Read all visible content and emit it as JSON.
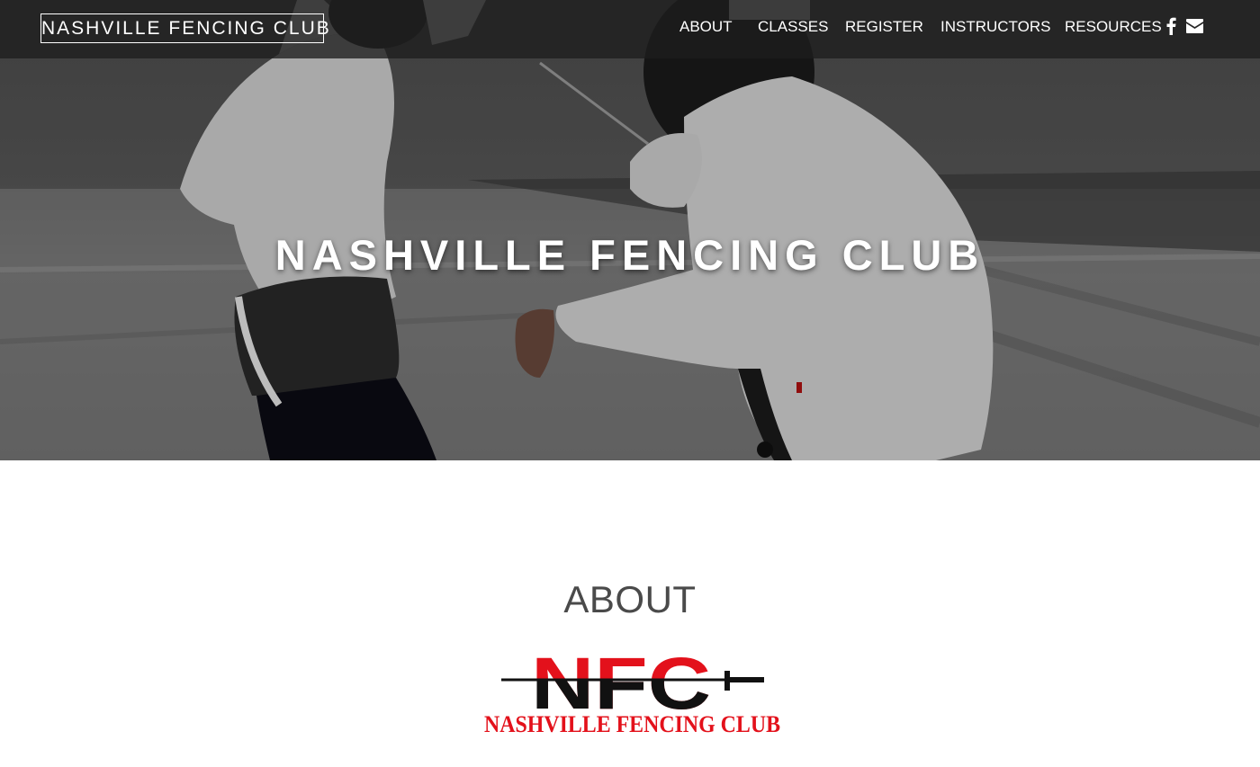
{
  "navbar": {
    "brand": "NASHVILLE FENCING CLUB",
    "links": [
      {
        "label": "ABOUT"
      },
      {
        "label": "CLASSES"
      },
      {
        "label": "REGISTER"
      },
      {
        "label": "INSTRUCTORS"
      },
      {
        "label": "RESOURCES"
      }
    ],
    "icons": [
      "facebook-icon",
      "envelope-icon"
    ]
  },
  "hero": {
    "title": "NASHVILLE FENCING CLUB"
  },
  "about": {
    "heading": "ABOUT",
    "logo": {
      "monogram": "NFC",
      "wordmark": "Nashville Fencing Club"
    }
  },
  "colors": {
    "logo_red": "#e3111b",
    "logo_black": "#111111",
    "heading_gray": "#4a4a4a",
    "navbar_bg": "#1e1e1e"
  }
}
